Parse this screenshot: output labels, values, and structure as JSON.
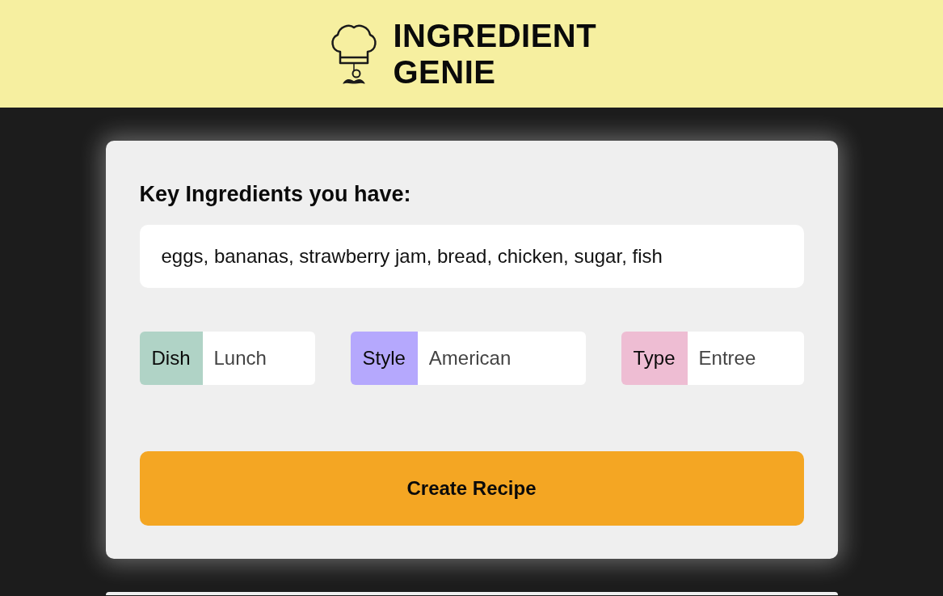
{
  "header": {
    "title": "INGREDIENT GENIE"
  },
  "ingredients": {
    "label": "Key Ingredients you have:",
    "value": "eggs, bananas, strawberry jam, bread, chicken, sugar, fish"
  },
  "options": [
    {
      "label": "Dish",
      "value": "Lunch",
      "color": "#b0d3c6"
    },
    {
      "label": "Style",
      "value": "American",
      "color": "#b5a8fd"
    },
    {
      "label": "Type",
      "value": "Entree",
      "color": "#eebdd3"
    }
  ],
  "create_button": {
    "label": "Create Recipe"
  }
}
